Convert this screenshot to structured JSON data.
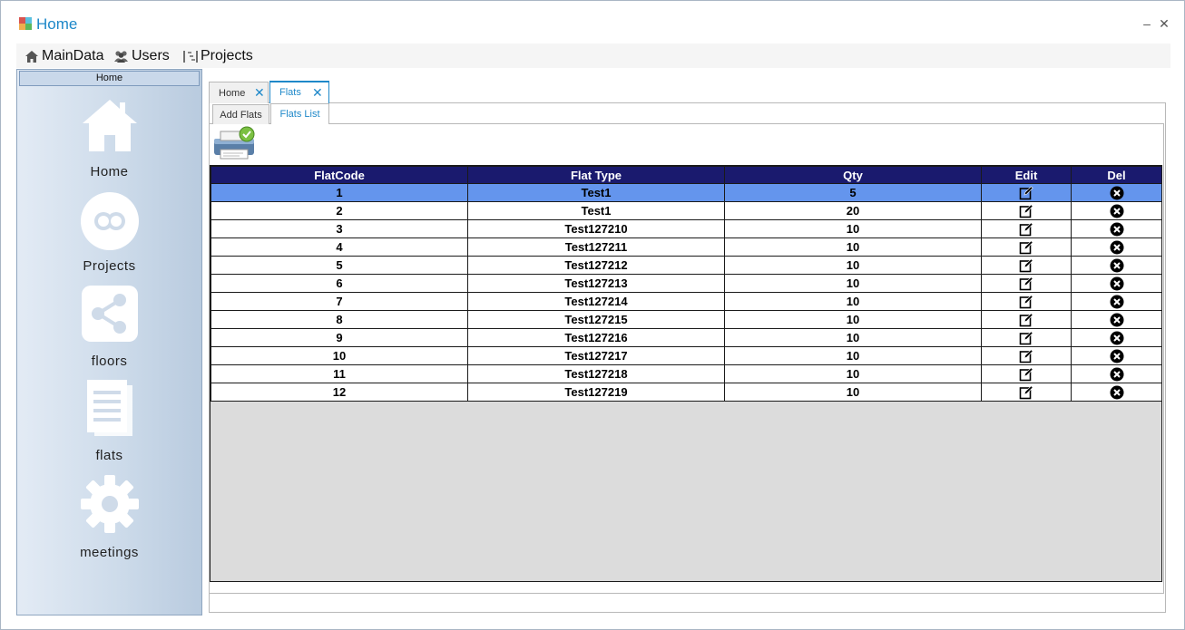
{
  "window": {
    "title": "Home",
    "minimize": "–",
    "close": "✕"
  },
  "menu": {
    "items": [
      {
        "label": "MainData",
        "icon": "home-icon"
      },
      {
        "label": "Users",
        "icon": "users-icon"
      },
      {
        "label": "Projects",
        "icon": "projects-icon"
      }
    ]
  },
  "sidebar": {
    "header": "Home",
    "items": [
      {
        "label": "Home",
        "icon": "house-icon"
      },
      {
        "label": "Projects",
        "icon": "circles-icon"
      },
      {
        "label": "floors",
        "icon": "share-icon"
      },
      {
        "label": "flats",
        "icon": "document-icon"
      },
      {
        "label": "meetings",
        "icon": "gear-icon"
      }
    ]
  },
  "tabs": [
    {
      "label": "Home",
      "close": "✕"
    },
    {
      "label": "Flats",
      "close": "✕"
    }
  ],
  "subtabs": [
    {
      "label": "Add Flats"
    },
    {
      "label": "Flats List"
    }
  ],
  "table": {
    "columns": [
      "FlatCode",
      "Flat Type",
      "Qty",
      "Edit",
      "Del"
    ],
    "rows": [
      {
        "code": "1",
        "type": "Test1",
        "qty": "5",
        "selected": true
      },
      {
        "code": "2",
        "type": "Test1",
        "qty": "20"
      },
      {
        "code": "3",
        "type": "Test127210",
        "qty": "10"
      },
      {
        "code": "4",
        "type": "Test127211",
        "qty": "10"
      },
      {
        "code": "5",
        "type": "Test127212",
        "qty": "10"
      },
      {
        "code": "6",
        "type": "Test127213",
        "qty": "10"
      },
      {
        "code": "7",
        "type": "Test127214",
        "qty": "10"
      },
      {
        "code": "8",
        "type": "Test127215",
        "qty": "10"
      },
      {
        "code": "9",
        "type": "Test127216",
        "qty": "10"
      },
      {
        "code": "10",
        "type": "Test127217",
        "qty": "10"
      },
      {
        "code": "11",
        "type": "Test127218",
        "qty": "10"
      },
      {
        "code": "12",
        "type": "Test127219",
        "qty": "10"
      }
    ]
  },
  "colors": {
    "accent": "#1e88c9",
    "header_bg": "#1a1a6e",
    "selected_row": "#6495ed",
    "grid_bg": "#dcdcdc"
  }
}
